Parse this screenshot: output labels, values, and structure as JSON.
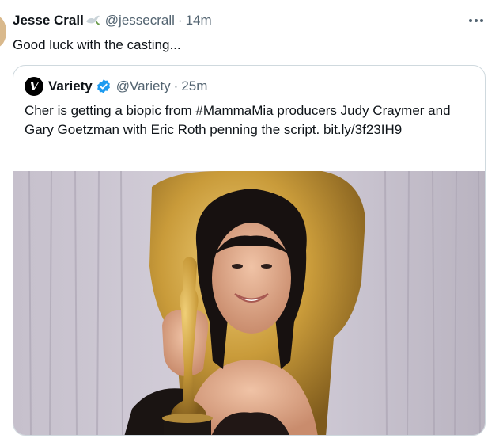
{
  "tweet": {
    "author_name": "Jesse Crall",
    "author_handle": "@jessecrall",
    "separator": "·",
    "timestamp": "14m",
    "text": "Good luck with the casting...",
    "more_icon": "more-horizontal-icon",
    "name_emoji": "dove-of-peace-icon"
  },
  "quoted_tweet": {
    "logo_letter": "V",
    "author_name": "Variety",
    "author_handle": "@Variety",
    "separator": "·",
    "timestamp": "25m",
    "text_part1": "Cher is getting a biopic from #MammaMia producers Judy Craymer and Gary Goetzman with Eric Roth penning the script.",
    "link": "bit.ly/3f23IH9",
    "verified_icon": "verified-badge-icon",
    "verified_color": "#1d9bf0"
  },
  "colors": {
    "text": "#0f1419",
    "secondary": "#536471",
    "border": "#cfd9de"
  }
}
